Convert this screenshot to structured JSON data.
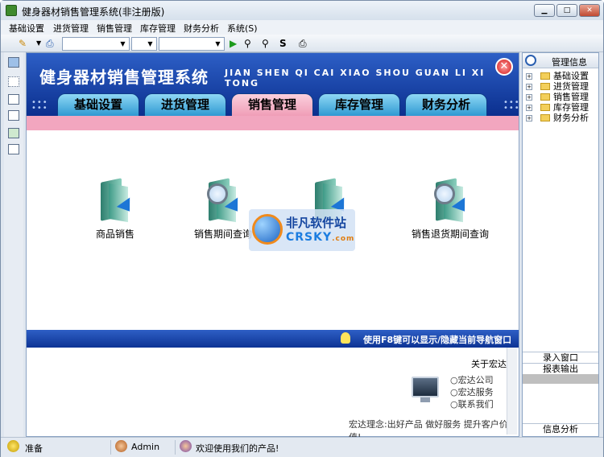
{
  "window": {
    "title": "健身器材销售管理系统(非注册版)"
  },
  "menu": [
    "基础设置",
    "进货管理",
    "销售管理",
    "库存管理",
    "财务分析",
    "系统(S)"
  ],
  "banner": {
    "title": "健身器材销售管理系统",
    "pinyin": "JIAN SHEN QI CAI XIAO SHOU GUAN LI XI TONG"
  },
  "tabs": [
    {
      "label": "基础设置",
      "active": false
    },
    {
      "label": "进货管理",
      "active": false
    },
    {
      "label": "销售管理",
      "active": true
    },
    {
      "label": "库存管理",
      "active": false
    },
    {
      "label": "财务分析",
      "active": false
    }
  ],
  "functions": [
    {
      "label": "商品销售",
      "icon": "folder-arrow-icon"
    },
    {
      "label": "销售期间查询",
      "icon": "folder-search-icon"
    },
    {
      "label": "",
      "icon": "folder-arrow-icon"
    },
    {
      "label": "销售退货期间查询",
      "icon": "folder-search-icon"
    }
  ],
  "watermark": {
    "cn": "非凡软件站",
    "en": "CRSKY",
    "com": ".com"
  },
  "hint": "使用F8键可以显示/隐藏当前导航窗口",
  "info": {
    "about": "关于宏达",
    "links": [
      "宏达公司",
      "宏达服务",
      "联系我们"
    ],
    "motto": "宏达理念:出好产品  做好服务  提升客户价值!"
  },
  "right_panel": {
    "title": "管理信息",
    "tree": [
      "基础设置",
      "进货管理",
      "销售管理",
      "库存管理",
      "财务分析"
    ],
    "buttons": [
      "录入窗口",
      "报表输出",
      "信息分析"
    ]
  },
  "status": {
    "ready": "准备",
    "user": "Admin",
    "welcome": "欢迎使用我们的产品!"
  },
  "colors": {
    "banner": "#0b2f8e",
    "tab": "#2e99d2",
    "active_tab": "#ef9ab4",
    "pink_bar": "#f2a6bf"
  }
}
